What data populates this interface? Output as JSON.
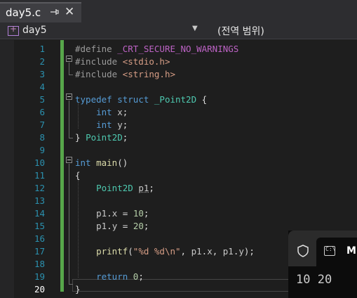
{
  "tab": {
    "title": "day5.c",
    "pin_icon": "pin-icon",
    "close_icon": "close-icon"
  },
  "navbar": {
    "project": "day5",
    "scope": "(전역 범위)"
  },
  "editor": {
    "current_line": 20,
    "lines": [
      {
        "n": "1",
        "tokens": [
          [
            "pp",
            "#define "
          ],
          [
            "macro",
            "_CRT_SECURE_NO_WARNINGS"
          ]
        ]
      },
      {
        "n": "2",
        "tokens": [
          [
            "pp",
            "#include "
          ],
          [
            "inc",
            "<stdio.h>"
          ]
        ]
      },
      {
        "n": "3",
        "tokens": [
          [
            "pp",
            "#include "
          ],
          [
            "inc",
            "<string.h>"
          ]
        ]
      },
      {
        "n": "4",
        "tokens": []
      },
      {
        "n": "5",
        "tokens": [
          [
            "kw",
            "typedef"
          ],
          [
            "pl",
            " "
          ],
          [
            "kw",
            "struct"
          ],
          [
            "pl",
            " "
          ],
          [
            "type",
            "_Point2D"
          ],
          [
            "pl",
            " {"
          ]
        ]
      },
      {
        "n": "6",
        "tokens": [
          [
            "pl",
            "    "
          ],
          [
            "kw",
            "int"
          ],
          [
            "pl",
            " "
          ],
          [
            "var",
            "x"
          ],
          [
            "pl",
            ";"
          ]
        ]
      },
      {
        "n": "7",
        "tokens": [
          [
            "pl",
            "    "
          ],
          [
            "kw",
            "int"
          ],
          [
            "pl",
            " "
          ],
          [
            "var",
            "y"
          ],
          [
            "pl",
            ";"
          ]
        ]
      },
      {
        "n": "8",
        "tokens": [
          [
            "pl",
            "} "
          ],
          [
            "type",
            "Point2D"
          ],
          [
            "pl",
            ";"
          ]
        ]
      },
      {
        "n": "9",
        "tokens": []
      },
      {
        "n": "10",
        "tokens": [
          [
            "kw",
            "int"
          ],
          [
            "pl",
            " "
          ],
          [
            "fn",
            "main"
          ],
          [
            "pl",
            "()"
          ]
        ]
      },
      {
        "n": "11",
        "tokens": [
          [
            "pl",
            "{"
          ]
        ]
      },
      {
        "n": "12",
        "tokens": [
          [
            "pl",
            "    "
          ],
          [
            "type",
            "Point2D"
          ],
          [
            "pl",
            " "
          ],
          [
            "var",
            "p1"
          ],
          [
            "pl",
            ";"
          ]
        ]
      },
      {
        "n": "13",
        "tokens": []
      },
      {
        "n": "14",
        "tokens": [
          [
            "pl",
            "    "
          ],
          [
            "var",
            "p1"
          ],
          [
            "pl",
            "."
          ],
          [
            "var",
            "x"
          ],
          [
            "pl",
            " = "
          ],
          [
            "num",
            "10"
          ],
          [
            "pl",
            ";"
          ]
        ]
      },
      {
        "n": "15",
        "tokens": [
          [
            "pl",
            "    "
          ],
          [
            "var",
            "p1"
          ],
          [
            "pl",
            "."
          ],
          [
            "var",
            "y"
          ],
          [
            "pl",
            " = "
          ],
          [
            "num",
            "20"
          ],
          [
            "pl",
            ";"
          ]
        ]
      },
      {
        "n": "16",
        "tokens": []
      },
      {
        "n": "17",
        "tokens": [
          [
            "pl",
            "    "
          ],
          [
            "fn",
            "printf"
          ],
          [
            "pl",
            "("
          ],
          [
            "str",
            "\"%d %d\\n\""
          ],
          [
            "pl",
            ", "
          ],
          [
            "var",
            "p1"
          ],
          [
            "pl",
            "."
          ],
          [
            "var",
            "x"
          ],
          [
            "pl",
            ", "
          ],
          [
            "var",
            "p1"
          ],
          [
            "pl",
            "."
          ],
          [
            "var",
            "y"
          ],
          [
            "pl",
            ");"
          ]
        ]
      },
      {
        "n": "18",
        "tokens": []
      },
      {
        "n": "19",
        "tokens": [
          [
            "pl",
            "    "
          ],
          [
            "kw",
            "return"
          ],
          [
            "pl",
            " "
          ],
          [
            "num",
            "0"
          ],
          [
            "pl",
            ";"
          ]
        ]
      },
      {
        "n": "20",
        "tokens": [
          [
            "pl",
            "}"
          ]
        ]
      }
    ]
  },
  "terminal": {
    "tab_title": "M",
    "output": "10 20",
    "shield_icon": "shield-icon",
    "cmd_icon": "command-prompt-icon",
    "cmd_glyph": "C:\\"
  }
}
